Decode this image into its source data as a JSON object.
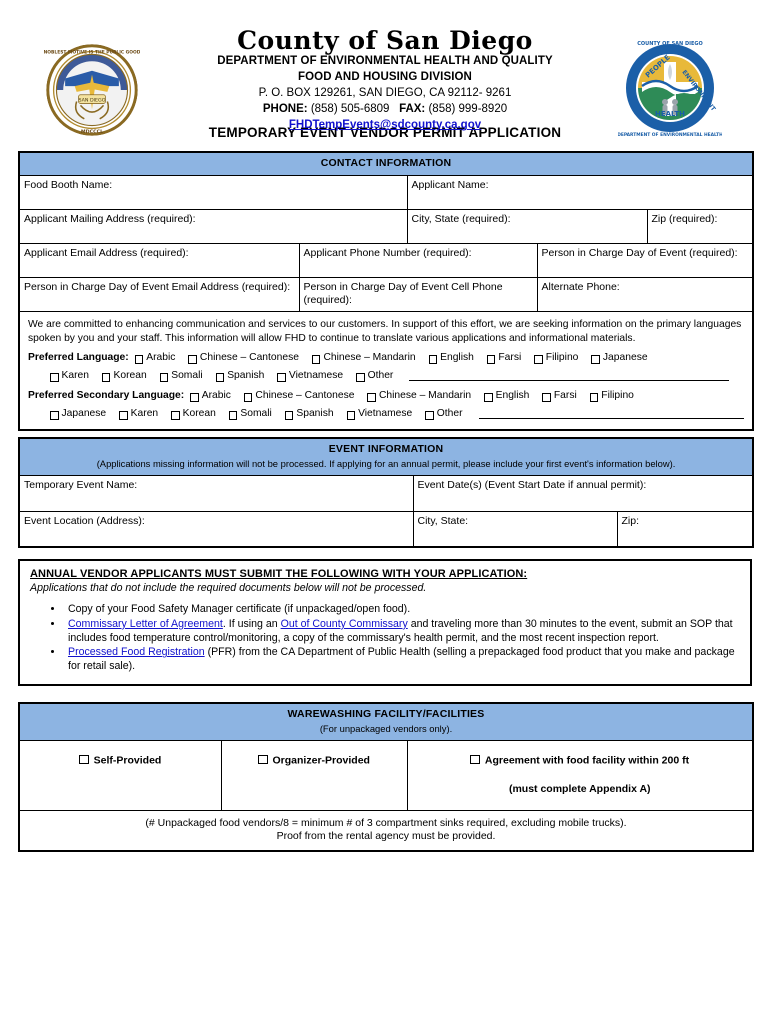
{
  "header": {
    "county_title": "County of San Diego",
    "dept_line1": "DEPARTMENT OF ENVIRONMENTAL HEALTH AND QUALITY",
    "dept_line2": "FOOD AND HOUSING DIVISION",
    "address": "P. O. BOX 129261, SAN DIEGO, CA 92112- 9261",
    "phone_label": "PHONE:",
    "phone_value": "(858) 505-6809",
    "fax_label": "FAX:",
    "fax_value": "(858) 999-8920",
    "email": "FHDTempEvents@sdcounty.ca.gov",
    "form_title": "TEMPORARY EVENT VENDOR PERMIT APPLICATION",
    "left_seal_name": "county-of-san-diego-seal",
    "right_seal_name": "deh-people-environment-health-logo",
    "right_seal_text": {
      "top": "COUNTY OF SAN DIEGO",
      "bottom": "DEPARTMENT OF ENVIRONMENTAL HEALTH",
      "people": "PEOPLE",
      "environment": "ENVIRONMENT",
      "health": "HEALTH"
    }
  },
  "contact": {
    "section_title": "CONTACT INFORMATION",
    "row1": {
      "food_booth_name": "Food Booth Name:",
      "applicant_name": "Applicant Name:"
    },
    "row2": {
      "mailing_address": "Applicant Mailing Address (required):",
      "city_state": "City, State (required):",
      "zip": "Zip (required):"
    },
    "row3": {
      "email": "Applicant Email Address (required):",
      "phone": "Applicant Phone Number (required):",
      "person_in_charge": "Person in Charge Day of Event (required):"
    },
    "row4": {
      "pic_email": "Person in Charge Day of Event Email Address (required):",
      "pic_cell": "Person in Charge Day of Event Cell Phone (required):",
      "alternate_phone": "Alternate Phone:"
    }
  },
  "language": {
    "paragraph": "We are committed to enhancing communication and services to our customers. In support of this effort, we are seeking information on the primary languages spoken by you and your staff. This information will allow FHD to continue to translate various applications and informational materials.",
    "preferred_label": "Preferred Language:",
    "secondary_label": "Preferred Secondary Language:",
    "other_label": "Other",
    "preferred_row1": [
      "Arabic",
      "Chinese – Cantonese",
      "Chinese – Mandarin",
      "English",
      "Farsi",
      "Filipino",
      "Japanese"
    ],
    "preferred_row2": [
      "Karen",
      "Korean",
      "Somali",
      "Spanish",
      "Vietnamese"
    ],
    "secondary_row1": [
      "Arabic",
      "Chinese – Cantonese",
      "Chinese – Mandarin",
      "English",
      "Farsi",
      "Filipino"
    ],
    "secondary_row2": [
      "Japanese",
      "Karen",
      "Korean",
      "Somali",
      "Spanish",
      "Vietnamese"
    ]
  },
  "event": {
    "section_title": "EVENT INFORMATION",
    "section_subtitle": "(Applications missing information will not be processed. If applying for an annual permit, please include your first event's information below).",
    "temporary_event_name": "Temporary Event Name:",
    "event_dates": "Event Date(s) (Event Start Date if annual permit):",
    "event_location": "Event Location (Address):",
    "city_state": "City, State:",
    "zip": "Zip:"
  },
  "annual": {
    "heading": "ANNUAL VENDOR APPLICANTS MUST SUBMIT THE FOLLOWING WITH YOUR APPLICATION:",
    "subheading": "Applications that do not include the required documents below will not be processed.",
    "bullet1": "Copy of your Food Safety Manager certificate (if unpackaged/open food).",
    "bullet2_link1": "Commissary Letter of Agreement",
    "bullet2_mid": ". If using an ",
    "bullet2_link2": "Out of County Commissary",
    "bullet2_rest": " and traveling more than 30 minutes to the event, submit an SOP that includes food temperature control/monitoring, a copy of the commissary's health permit, and the most recent inspection report.",
    "bullet3_link": "Processed Food Registration",
    "bullet3_rest": " (PFR) from the CA Department of Public Health (selling a prepackaged food product that you make and package for retail sale)."
  },
  "warewashing": {
    "section_title": "WAREWASHING FACILITY/FACILITIES",
    "section_subtitle": "(For unpackaged vendors only).",
    "option_self": "Self-Provided",
    "option_organizer": "Organizer-Provided",
    "option_agreement": "Agreement with food facility within 200 ft",
    "option_agreement_second": "(must complete Appendix A)",
    "note_line1": "(# Unpackaged food vendors/8 = minimum # of 3 compartment sinks required, excluding mobile trucks).",
    "note_line2": "Proof from the rental agency must be provided."
  },
  "colors": {
    "header_blue": "#8db4e2",
    "link_blue": "#1111cc",
    "border_black": "#000000"
  }
}
